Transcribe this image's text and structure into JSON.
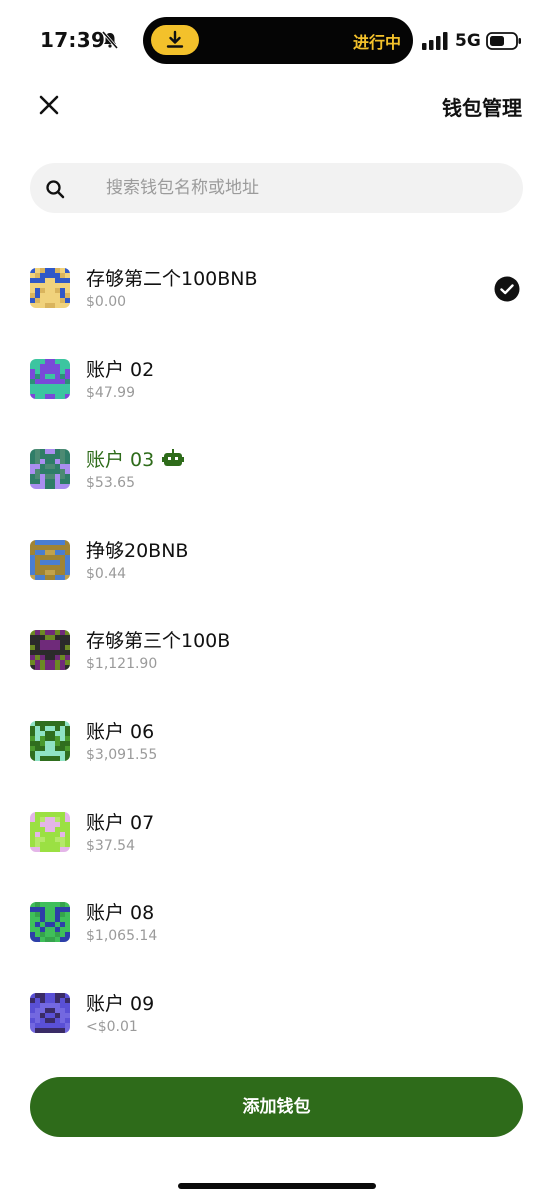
{
  "status_bar": {
    "time": "17:39",
    "progress_text": "进行中",
    "network": "5G",
    "accent_color": "#f3c12b"
  },
  "header": {
    "title": "钱包管理",
    "close_icon": "close-icon"
  },
  "search": {
    "placeholder": "搜索钱包名称或地址",
    "value": ""
  },
  "wallets": [
    {
      "name": "存够第二个100BNB",
      "balance": "$0.00",
      "selected": true,
      "avatar_colors": [
        "#f0d27c",
        "#2f58c7",
        "#d9b45d"
      ]
    },
    {
      "name": "账户 02",
      "balance": "$47.99",
      "avatar_colors": [
        "#3cc5a0",
        "#7a49d8",
        "#2e8f78"
      ]
    },
    {
      "name": "账户 03",
      "balance": "$53.65",
      "active": true,
      "badge_icon": "robot-icon",
      "avatar_colors": [
        "#2f7d68",
        "#a98ef0",
        "#4c8a73"
      ]
    },
    {
      "name": "挣够20BNB",
      "balance": "$0.44",
      "avatar_colors": [
        "#a08433",
        "#4a7ed0",
        "#c2a24c"
      ]
    },
    {
      "name": "存够第三个100B",
      "balance": "$1,121.90",
      "avatar_colors": [
        "#2b2b2b",
        "#6f2a7a",
        "#6c8a24"
      ]
    },
    {
      "name": "账户 06",
      "balance": "$3,091.55",
      "avatar_colors": [
        "#2f6e1e",
        "#8fe3c5",
        "#4a9a2e"
      ]
    },
    {
      "name": "账户 07",
      "balance": "$37.54",
      "avatar_colors": [
        "#9be043",
        "#e4b5e8",
        "#b5e86a"
      ]
    },
    {
      "name": "账户 08",
      "balance": "$1,065.14",
      "avatar_colors": [
        "#3fbf5a",
        "#2d3fa8",
        "#35a34c"
      ]
    },
    {
      "name": "账户 09",
      "balance": "<$0.01",
      "avatar_colors": [
        "#5a50d6",
        "#3a2b66",
        "#7368e0"
      ]
    }
  ],
  "add_button": {
    "label": "添加钱包",
    "color": "#2e6b1a"
  }
}
